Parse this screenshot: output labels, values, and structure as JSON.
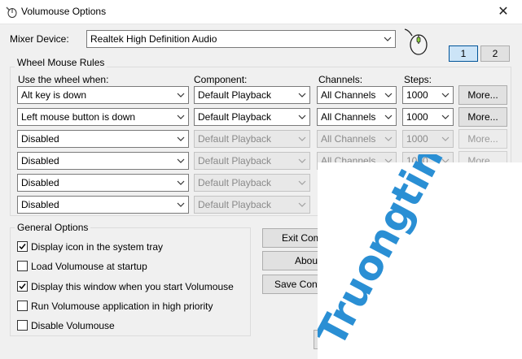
{
  "window": {
    "title": "Volumouse Options",
    "close_glyph": "✕"
  },
  "mixer": {
    "label": "Mixer Device:",
    "value": "Realtek High Definition Audio",
    "tabs": [
      "1",
      "2"
    ]
  },
  "rules": {
    "legend": "Wheel Mouse Rules",
    "headers": {
      "use": "Use the wheel when:",
      "component": "Component:",
      "channels": "Channels:",
      "steps": "Steps:"
    },
    "rows": [
      {
        "use": "Alt key is down",
        "component": "Default Playback",
        "channels": "All Channels",
        "steps": "1000",
        "more": "More...",
        "enabled": true
      },
      {
        "use": "Left mouse button is down",
        "component": "Default Playback",
        "channels": "All Channels",
        "steps": "1000",
        "more": "More...",
        "enabled": true
      },
      {
        "use": "Disabled",
        "component": "Default Playback",
        "channels": "All Channels",
        "steps": "1000",
        "more": "More...",
        "enabled": false
      },
      {
        "use": "Disabled",
        "component": "Default Playback",
        "channels": "All Channels",
        "steps": "1000",
        "more": "More...",
        "enabled": false
      },
      {
        "use": "Disabled",
        "component": "Default Playback",
        "channels": "",
        "steps": "",
        "more": "",
        "enabled": false
      },
      {
        "use": "Disabled",
        "component": "Default Playback",
        "channels": "",
        "steps": "",
        "more": "",
        "enabled": false
      }
    ]
  },
  "general": {
    "legend": "General Options",
    "options": [
      {
        "label": "Display icon in the system tray",
        "checked": true
      },
      {
        "label": "Load Volumouse at startup",
        "checked": false
      },
      {
        "label": "Display this window when you start Volumouse",
        "checked": true
      },
      {
        "label": "Run Volumouse application in high priority",
        "checked": false
      },
      {
        "label": "Disable Volumouse",
        "checked": false
      }
    ]
  },
  "side_buttons": [
    "Exit Comp",
    "About",
    "Save Confi"
  ],
  "watermark": {
    "text": "Truongtin.top",
    "color": "#2a8fd4"
  }
}
